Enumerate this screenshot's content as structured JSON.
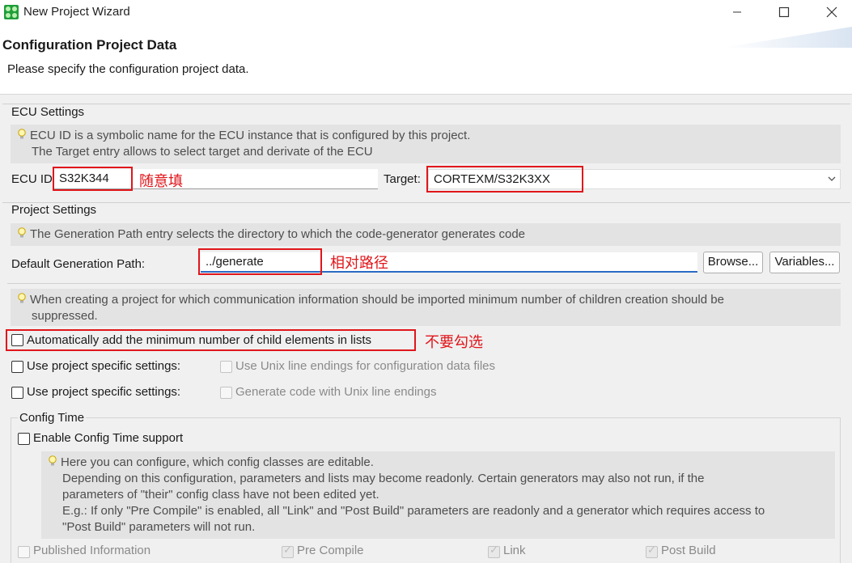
{
  "window": {
    "title": "New Project Wizard"
  },
  "header": {
    "title": "Configuration Project Data",
    "description": "Please specify the configuration project data."
  },
  "ecu": {
    "group_title": "ECU Settings",
    "info_line1": "ECU ID is a symbolic name for the ECU instance that is configured by this project.",
    "info_line2": "The Target entry allows to select target and derivate of the ECU",
    "id_label": "ECU ID:",
    "id_value": "S32K344",
    "id_annotation": "随意填",
    "target_label": "Target:",
    "target_value": "CORTEXM/S32K3XX"
  },
  "project": {
    "group_title": "Project Settings",
    "info": "The Generation Path entry selects the directory to which the code-generator generates code",
    "path_label": "Default Generation Path:",
    "path_value": "../generate",
    "path_annotation": "相对路径",
    "browse_label": "Browse...",
    "variables_label": "Variables...",
    "children_info_line1": "When creating a project for which communication information should be imported minimum number of children creation should be",
    "children_info_line2": "suppressed.",
    "auto_add_label": "Automatically add the minimum number of child elements in lists",
    "auto_add_checked": false,
    "auto_add_annotation": "不要勾选",
    "specific1_label": "Use project specific settings:",
    "unix_config_label": "Use Unix line endings for configuration data files",
    "specific2_label": "Use project specific settings:",
    "unix_gen_label": "Generate code with Unix line endings"
  },
  "config_time": {
    "group_title": "Config Time",
    "enable_label": "Enable Config Time support",
    "info_line1": "Here you can configure, which config classes are editable.",
    "info_line2": "Depending on this configuration, parameters and lists may become readonly. Certain generators may also not run, if the",
    "info_line3": "parameters of \"their\" config class have not been edited yet.",
    "info_line4": "E.g.: If only \"Pre Compile\" is enabled, all \"Link\" and \"Post Build\" parameters are readonly and a generator which requires access to",
    "info_line5": "\"Post Build\" parameters will not run.",
    "classes": [
      {
        "label": "Published Information",
        "checked": false
      },
      {
        "label": "Pre Compile",
        "checked": true
      },
      {
        "label": "Link",
        "checked": true
      },
      {
        "label": "Post Build",
        "checked": true
      }
    ]
  },
  "colors": {
    "annotation_red": "#e0161b",
    "info_bg": "#e3e3e3",
    "app_icon_green": "#1f9d3a"
  },
  "icons": [
    "app-icon",
    "minimize-icon",
    "maximize-icon",
    "close-icon",
    "lightbulb-icon",
    "chevron-down-icon"
  ]
}
